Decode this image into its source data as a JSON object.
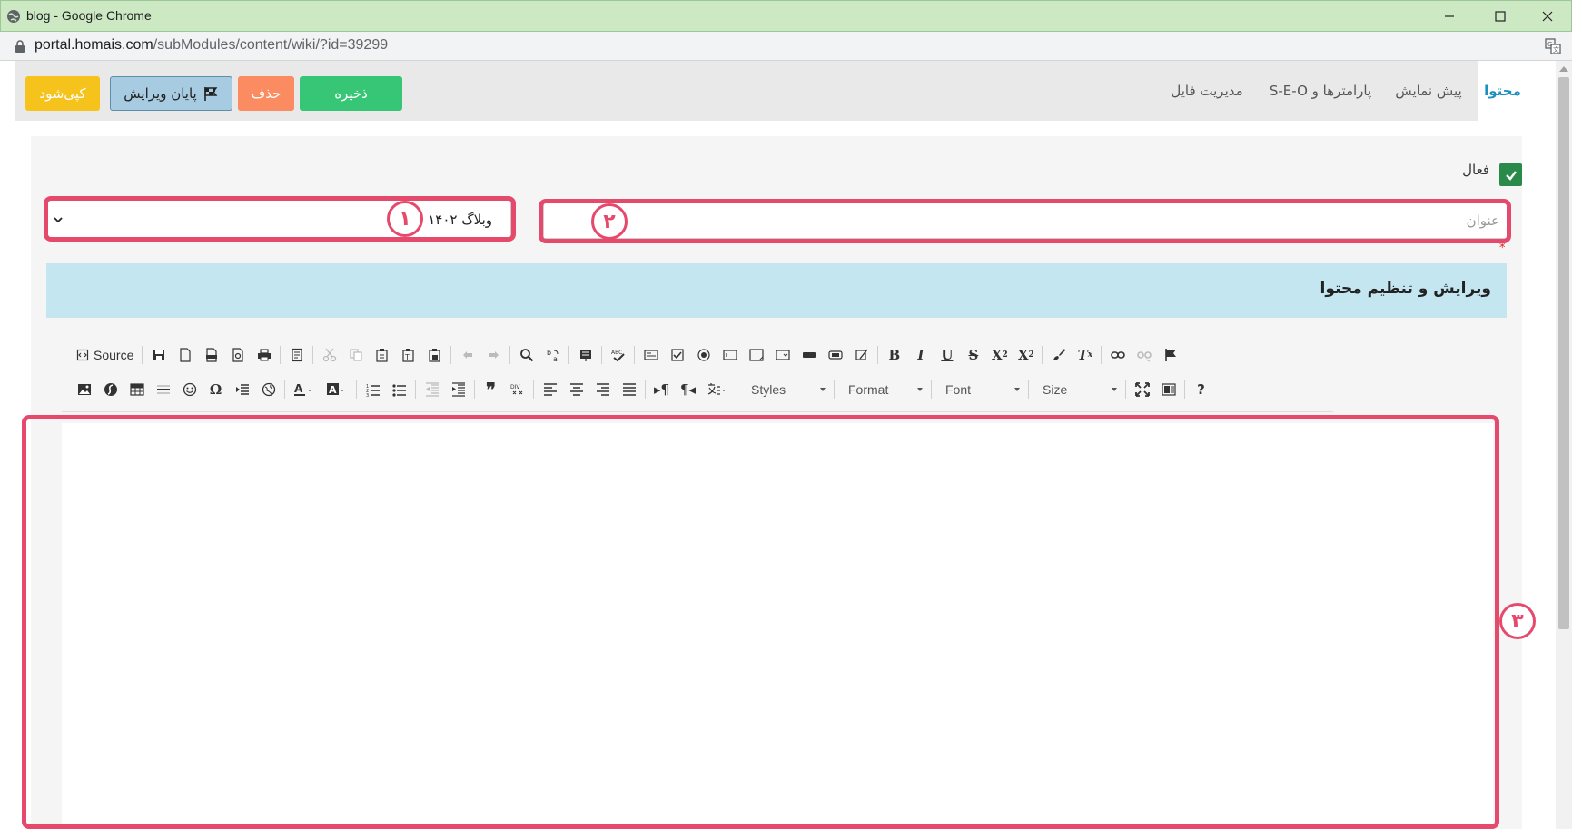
{
  "window": {
    "title": "blog - Google Chrome",
    "url_host": "portal.homais.com",
    "url_path": "/subModules/content/wiki/?id=39299"
  },
  "tabs": [
    {
      "label": "محتوا",
      "active": true
    },
    {
      "label": "پیش نمایش",
      "active": false
    },
    {
      "label": "پارامترها و S-E-O",
      "active": false
    },
    {
      "label": "مدیریت فایل",
      "active": false
    }
  ],
  "actions": {
    "save": "ذخیره",
    "delete": "حذف",
    "finish_edit": "پایان ویرایش",
    "copy": "کپی‌شود"
  },
  "form": {
    "active_label": "فعال",
    "category_value": "وبلاگ ۱۴۰۲",
    "title_placeholder": "عنوان",
    "required_mark": "*"
  },
  "section_title": "ویرایش و تنظیم محتوا",
  "toolbar": {
    "source_label": "Source",
    "styles": "Styles",
    "format": "Format",
    "font": "Font",
    "size": "Size"
  },
  "annotations": [
    "۱",
    "۲",
    "۳"
  ],
  "colors": {
    "titlebar": "#cce9c4",
    "save": "#37c675",
    "delete": "#fb8c62",
    "finish": "#a7cbe0",
    "copy": "#f6c21c",
    "banner": "#c3e6f0",
    "annotation": "#e54a6d",
    "active_tab": "#1a8fc1"
  }
}
